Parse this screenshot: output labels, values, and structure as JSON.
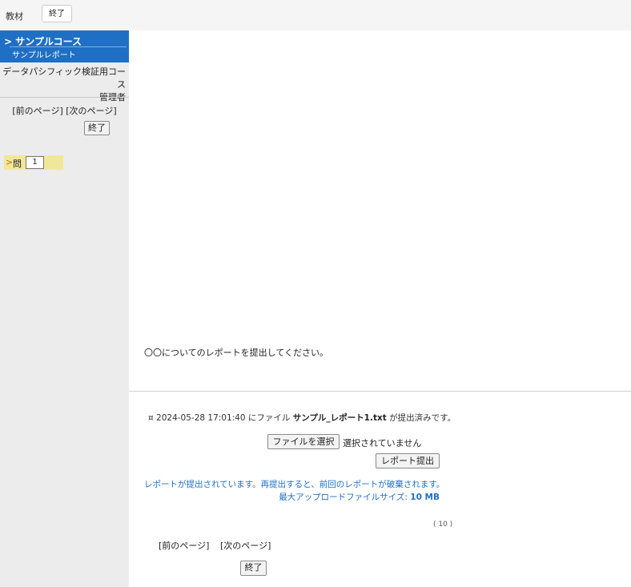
{
  "topbar": {
    "label": "教材",
    "end_button": "終了"
  },
  "sidebar": {
    "course_arrow": ">",
    "course_title": "サンプルコース",
    "report_title": "サンプルレポート",
    "org_name": "データパシフィック検証用コース",
    "role": "管理者",
    "prev_page": "[前のページ]",
    "next_page": "[次のページ]",
    "end_button": "終了",
    "question_arrow": ">",
    "question_label": "問",
    "question_number": "1"
  },
  "main": {
    "question_text": "〇〇についてのレポートを提出してください。",
    "status": {
      "bullet": "¤",
      "timestamp": "2024-05-28 17:01:40",
      "prefix": "にファイル",
      "filename": "サンプル_レポート1.txt",
      "suffix": "が提出済みです。"
    },
    "file_select_button": "ファイルを選択",
    "file_select_status": "選択されていません",
    "submit_button": "レポート提出",
    "warning": "レポートが提出されています。再提出すると、前回のレポートが破棄されます。",
    "max_size_label": "最大アップロードファイルサイズ:",
    "max_size_value": "10 MB",
    "page_indicator": "( 10 )",
    "prev_page": "[前のページ]",
    "next_page": "[次のページ]",
    "end_button": "終了"
  }
}
